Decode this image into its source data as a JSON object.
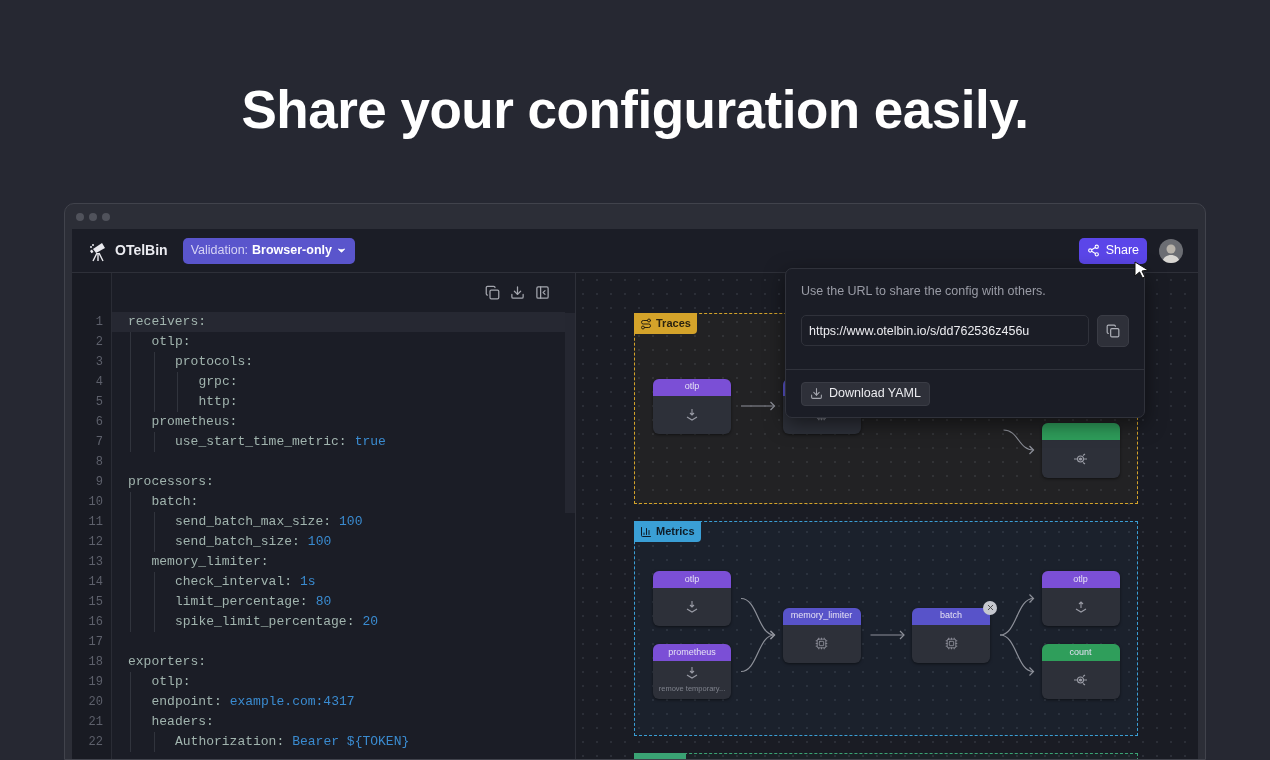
{
  "headline": "Share your configuration easily.",
  "app": {
    "logo": "OTelBin",
    "validation": {
      "label": "Validation:",
      "value": "Browser-only"
    },
    "share_button": "Share"
  },
  "share_popover": {
    "hint": "Use the URL to share the config with others.",
    "url": "https://www.otelbin.io/s/dd762536z456u",
    "download_button": "Download YAML"
  },
  "editor": {
    "lines": [
      {
        "number": "1",
        "key": "receivers:",
        "active": true,
        "children": [
          {
            "number": "2",
            "key": "otlp:",
            "active": false,
            "children": [
              {
                "number": "3",
                "key": "protocols:",
                "active": false,
                "children": [
                  {
                    "number": "4",
                    "key": "grpc:",
                    "active": false
                  },
                  {
                    "number": "5",
                    "key": "http:",
                    "active": false
                  }
                ]
              }
            ]
          },
          {
            "number": "6",
            "key": "prometheus:",
            "active": false,
            "children": [
              {
                "number": "7",
                "key": "use_start_time_metric:",
                "value": "true",
                "active": false
              }
            ]
          }
        ]
      },
      {
        "number": "8",
        "active": false
      },
      {
        "number": "9",
        "key": "processors:",
        "active": false,
        "children": [
          {
            "number": "10",
            "key": "batch:",
            "active": false,
            "children": [
              {
                "number": "11",
                "key": "send_batch_max_size:",
                "value": "100",
                "active": false
              },
              {
                "number": "12",
                "key": "send_batch_size:",
                "value": "100",
                "active": false
              }
            ]
          },
          {
            "number": "13",
            "key": "memory_limiter:",
            "active": false,
            "children": [
              {
                "number": "14",
                "key": "check_interval:",
                "value": "1s",
                "active": false
              },
              {
                "number": "15",
                "key": "limit_percentage:",
                "value": "80",
                "active": false
              },
              {
                "number": "16",
                "key": "spike_limit_percentage:",
                "value": "20",
                "active": false
              }
            ]
          }
        ]
      },
      {
        "number": "17",
        "active": false
      },
      {
        "number": "18",
        "key": "exporters:",
        "active": false,
        "children": [
          {
            "number": "19",
            "key": "otlp:",
            "active": false
          },
          {
            "number": "20",
            "key": "endpoint:",
            "value": "example.com:4317",
            "active": false
          },
          {
            "number": "21",
            "key": "headers:",
            "active": false,
            "children": [
              {
                "number": "22",
                "key": "Authorization:",
                "value": "Bearer ${TOKEN}",
                "active": false
              }
            ]
          }
        ]
      }
    ]
  },
  "pipelines": [
    {
      "kind": "traces",
      "label": "Traces",
      "color": "#d4a32a",
      "columns": [
        [
          {
            "kind": "receiver",
            "label": "otlp",
            "delete_badge": false
          }
        ],
        [
          {
            "kind": "processor"
          }
        ],
        [],
        [
          {
            "kind": "connector"
          }
        ]
      ]
    },
    {
      "kind": "metrics",
      "label": "Metrics",
      "color": "#3a9fd6",
      "columns": [
        [
          {
            "kind": "receiver",
            "label": "otlp",
            "delete_badge": false
          },
          {
            "kind": "receiver",
            "label": "prometheus",
            "note": "remove temporary...",
            "delete_badge": false
          }
        ],
        [
          {
            "kind": "processor",
            "label": "memory_limiter",
            "delete_badge": false
          }
        ],
        [
          {
            "kind": "processor",
            "label": "batch",
            "delete_badge": true
          }
        ],
        [
          {
            "kind": "exporter",
            "label": "otlp",
            "delete_badge": false
          },
          {
            "kind": "connector",
            "label": "count",
            "delete_badge": false
          }
        ]
      ]
    },
    {
      "kind": "group",
      "color": "#3aa374"
    }
  ]
}
